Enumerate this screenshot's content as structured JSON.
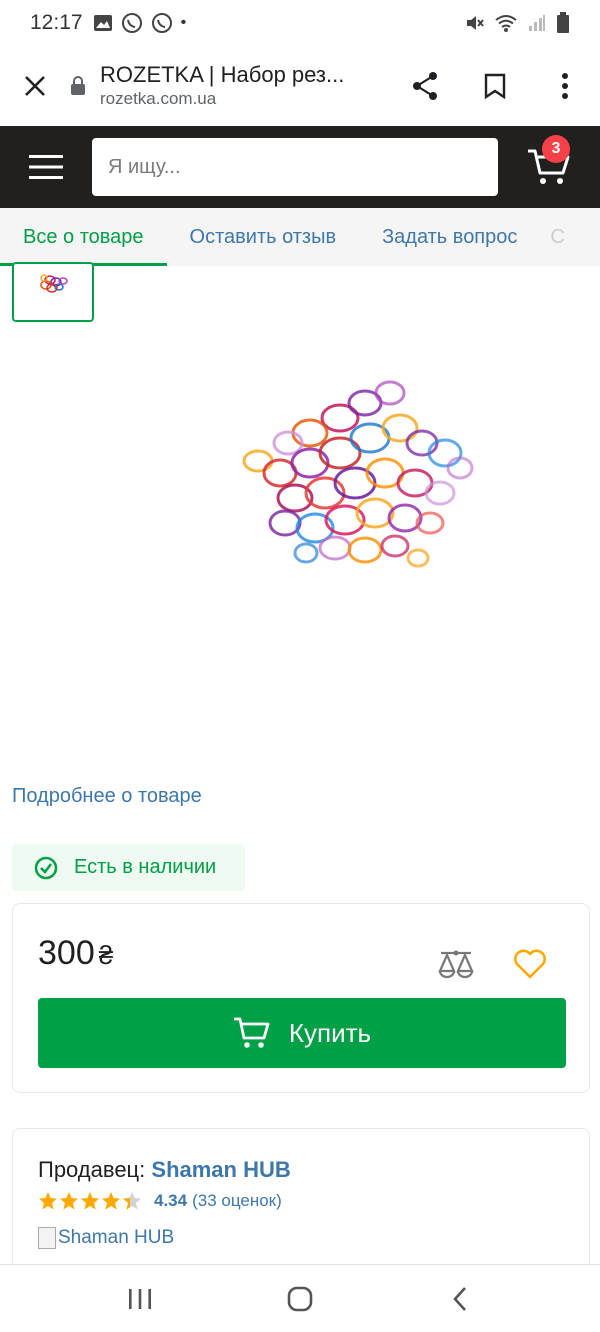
{
  "status_bar": {
    "time": "12:17",
    "dot": "•",
    "icons_left": [
      "gallery-icon",
      "viber-icon",
      "viber-icon"
    ],
    "icons_right": [
      "mute-icon",
      "wifi-icon",
      "signal-icon",
      "battery-icon"
    ]
  },
  "browser": {
    "page_title": "ROZETKA | Набор рез...",
    "domain": "rozetka.com.ua"
  },
  "header": {
    "search_placeholder": "Я ищу...",
    "cart_count": "3"
  },
  "tabs": [
    {
      "label": "Все о товаре",
      "active": true
    },
    {
      "label": "Оставить отзыв",
      "active": false
    },
    {
      "label": "Задать вопрос",
      "active": false
    },
    {
      "label": "С",
      "active": false
    }
  ],
  "product": {
    "details_link": "Подробнее о товаре",
    "stock_status": "Есть в наличии",
    "price": "300",
    "currency": "₴",
    "buy_label": "Купить"
  },
  "seller": {
    "label": "Продавец:",
    "name": "Shaman HUB",
    "rating": "4.34",
    "rating_count": "(33 оценок)",
    "stars_filled": 4.34,
    "logo_alt": "Shaman HUB"
  },
  "colors": {
    "brand_dark": "#221f1f",
    "accent_green": "#00a046",
    "link_blue": "#3e77aa",
    "badge_red": "#f84147",
    "star": "#ffa900"
  }
}
